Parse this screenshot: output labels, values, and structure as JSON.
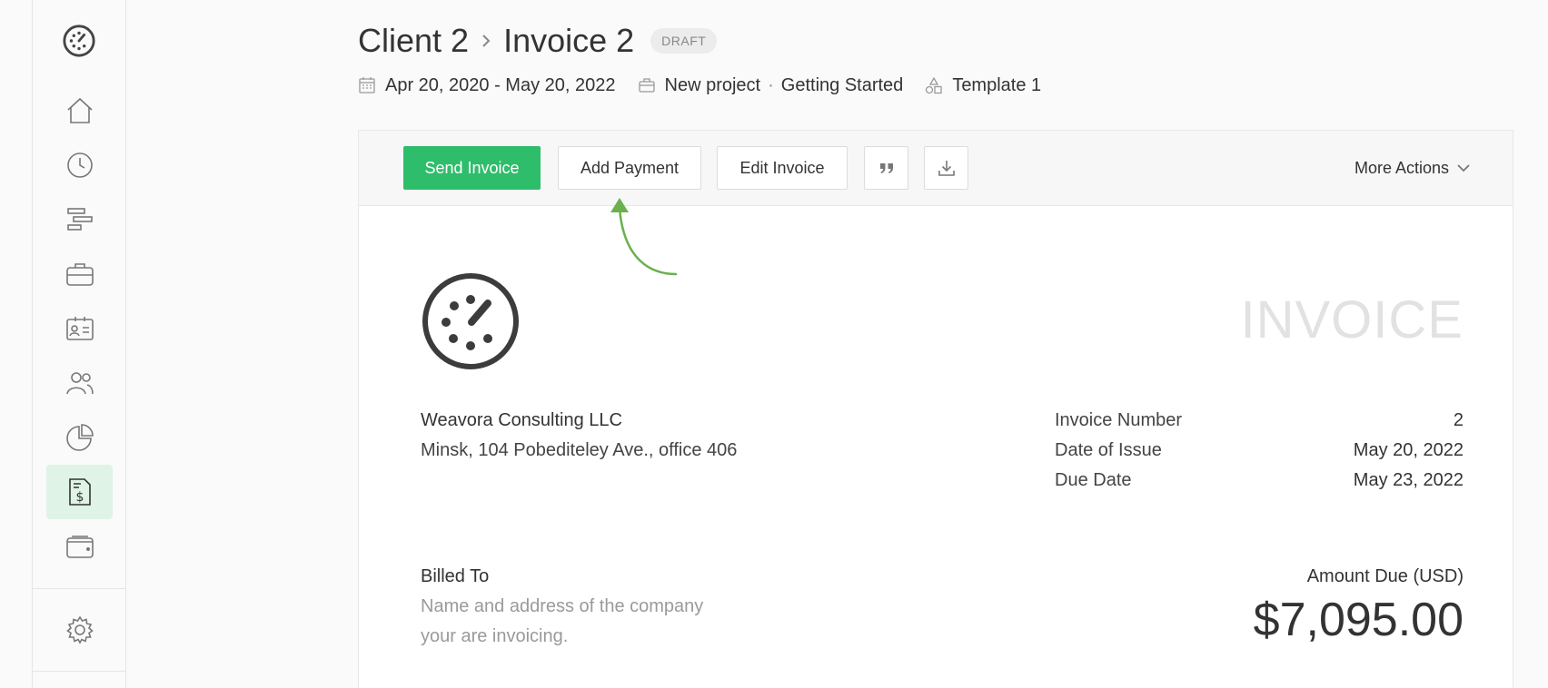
{
  "breadcrumb": {
    "client": "Client 2",
    "invoice": "Invoice 2",
    "status": "DRAFT"
  },
  "meta": {
    "date_range": "Apr 20, 2020 - May 20, 2022",
    "project": "New project",
    "separator": "·",
    "task": "Getting Started",
    "template": "Template 1"
  },
  "toolbar": {
    "send": "Send Invoice",
    "add_payment": "Add Payment",
    "edit": "Edit Invoice",
    "more": "More Actions"
  },
  "invoice": {
    "heading": "INVOICE",
    "company_name": "Weavora Consulting LLC",
    "company_address": "Minsk, 104 Pobediteley Ave., office 406",
    "details": [
      {
        "label": "Invoice Number",
        "value": "2"
      },
      {
        "label": "Date of Issue",
        "value": "May 20, 2022"
      },
      {
        "label": "Due Date",
        "value": "May 23, 2022"
      }
    ],
    "billed_to_label": "Billed To",
    "billed_to_placeholder": "Name and address of the company your are invoicing.",
    "amount_due_label": "Amount Due (USD)",
    "amount_due": "$7,095.00"
  },
  "colors": {
    "accent": "#2ebd6b",
    "active_bg": "#dff3e7",
    "annotation": "#6ab04c"
  },
  "icons": [
    "home-icon",
    "clock-icon",
    "timeline-icon",
    "briefcase-icon",
    "contact-card-icon",
    "users-icon",
    "pie-chart-icon",
    "invoice-icon",
    "wallet-icon",
    "settings-icon"
  ]
}
